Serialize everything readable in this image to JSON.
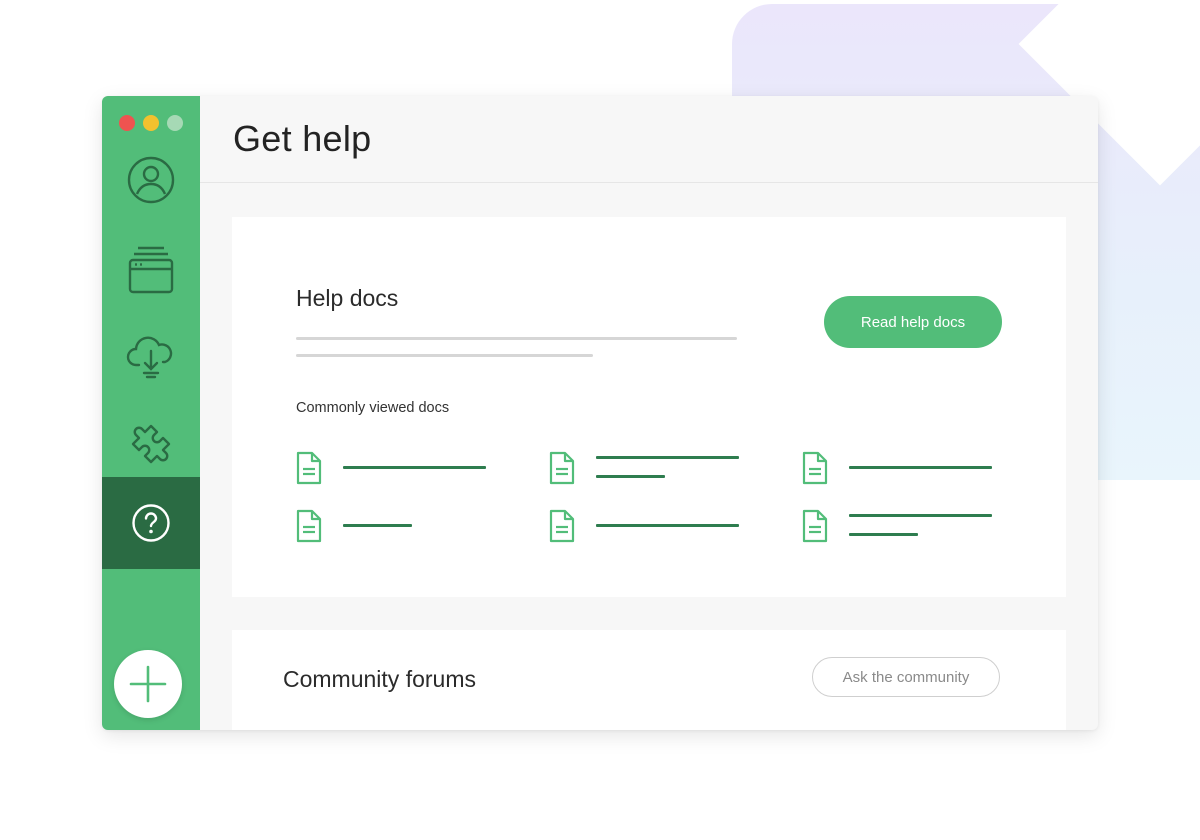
{
  "header": {
    "title": "Get help"
  },
  "sidebar": {
    "items": [
      {
        "name": "profile",
        "icon": "user-circle-icon"
      },
      {
        "name": "projects",
        "icon": "window-stack-icon"
      },
      {
        "name": "deploy",
        "icon": "cloud-download-icon"
      },
      {
        "name": "integrations",
        "icon": "puzzle-icon"
      },
      {
        "name": "help",
        "icon": "question-circle-icon",
        "active": true
      }
    ],
    "add_icon": "plus-icon"
  },
  "help_docs": {
    "title": "Help docs",
    "button_label": "Read help docs",
    "commonly_viewed_label": "Commonly viewed docs"
  },
  "community": {
    "title": "Community forums",
    "button_label": "Ask the community"
  },
  "colors": {
    "accent": "#52bd79",
    "sidebar_active": "#2a6b43",
    "doc_line": "#2e7d4f",
    "traffic_red": "#ef5350",
    "traffic_yellow": "#f2c12e"
  }
}
